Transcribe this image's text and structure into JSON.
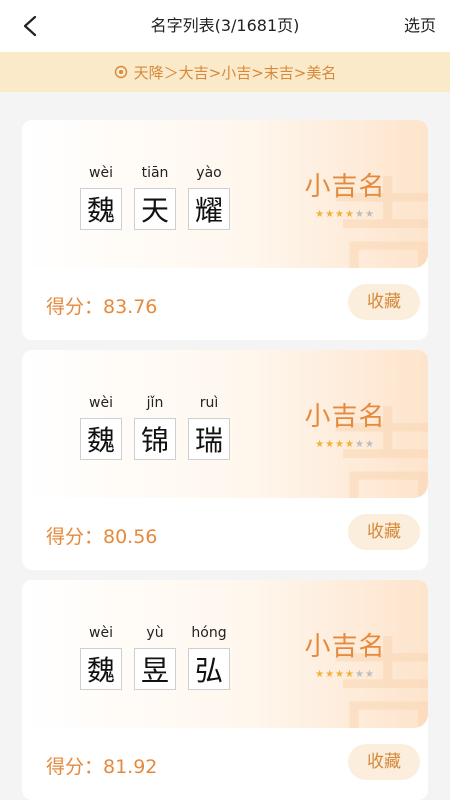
{
  "header": {
    "title": "名字列表(3/1681页)",
    "select_page": "选页"
  },
  "banner": {
    "text": "天降＞大吉>小吉>末吉>美名"
  },
  "cards": [
    {
      "chars": [
        {
          "char": "魏",
          "pinyin": "wèi"
        },
        {
          "char": "天",
          "pinyin": "tiān"
        },
        {
          "char": "耀",
          "pinyin": "yào"
        }
      ],
      "rating_label": "小吉名",
      "stars": 4,
      "stars_total": 6,
      "watermark": "吉",
      "score": "得分：83.76",
      "collect_label": "收藏"
    },
    {
      "chars": [
        {
          "char": "魏",
          "pinyin": "wèi"
        },
        {
          "char": "锦",
          "pinyin": "jǐn"
        },
        {
          "char": "瑞",
          "pinyin": "ruì"
        }
      ],
      "rating_label": "小吉名",
      "stars": 4,
      "stars_total": 6,
      "watermark": "吉",
      "score": "得分：80.56",
      "collect_label": "收藏"
    },
    {
      "chars": [
        {
          "char": "魏",
          "pinyin": "wèi"
        },
        {
          "char": "昱",
          "pinyin": "yù"
        },
        {
          "char": "弘",
          "pinyin": "hóng"
        }
      ],
      "rating_label": "小吉名",
      "stars": 4,
      "stars_total": 6,
      "watermark": "吉",
      "score": "得分：81.92",
      "collect_label": "收藏"
    }
  ],
  "colors": {
    "accent": "#e58a3d",
    "banner_bg": "#fbeac9",
    "star_on": "#f1b23c",
    "star_off": "#bdbdbd"
  },
  "icons": {
    "back": "chevron-left-icon",
    "banner": "target-icon",
    "star": "star-icon"
  }
}
